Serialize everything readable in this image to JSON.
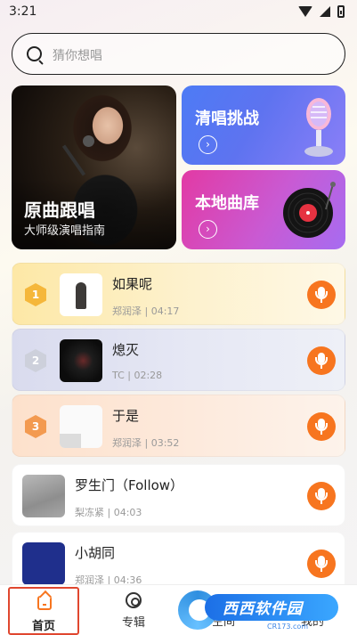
{
  "status_bar": {
    "time": "3:21"
  },
  "search": {
    "placeholder": "猜你想唱"
  },
  "hero": {
    "main": {
      "title": "原曲跟唱",
      "subtitle": "大师级演唱指南"
    },
    "challenge": {
      "title": "清唱挑战",
      "arrow": "›"
    },
    "library": {
      "title": "本地曲库",
      "arrow": "›"
    }
  },
  "songs": [
    {
      "rank": "1",
      "title": "如果呢",
      "meta": "郑润泽 | 04:17"
    },
    {
      "rank": "2",
      "title": "熄灭",
      "meta": "TC | 02:28"
    },
    {
      "rank": "3",
      "title": "于是",
      "meta": "郑润泽 | 03:52"
    },
    {
      "title": "罗生门（Follow）",
      "meta": "梨冻紧 | 04:03"
    },
    {
      "title": "小胡同",
      "meta": "郑润泽 | 04:36"
    }
  ],
  "nav": {
    "home": "首页",
    "album": "专辑",
    "partial_1": "空间",
    "partial_2": "我的"
  },
  "watermark": {
    "text": "西西软件园",
    "url": "CR173.com"
  },
  "colors": {
    "accent": "#f7751f",
    "nav_highlight": "#e0472f",
    "challenge_card": "#5e73f0",
    "library_card": "#d04bc0"
  }
}
